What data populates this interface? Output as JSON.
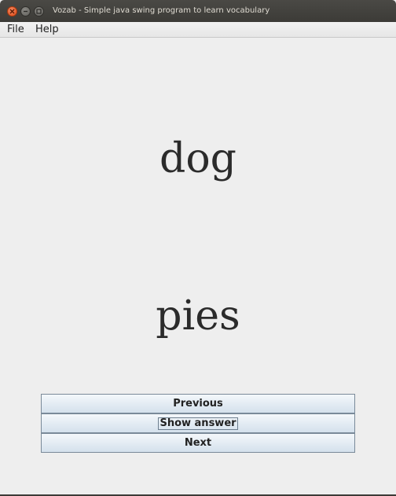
{
  "window": {
    "title": "Vozab - Simple java swing program to learn vocabulary"
  },
  "menubar": {
    "items": [
      {
        "label": "File"
      },
      {
        "label": "Help"
      }
    ]
  },
  "card": {
    "question": "dog",
    "answer": "pies"
  },
  "buttons": {
    "previous": "Previous",
    "show_answer": "Show answer",
    "next": "Next"
  },
  "colors": {
    "titlebar": "#3c3b37",
    "close_button": "#df4a16",
    "window_bg": "#eeeeee",
    "button_gradient_top": "#f4f8fb",
    "button_gradient_bottom": "#d4e1ec",
    "button_border": "#7a8a99"
  },
  "icons": {
    "close": "close-icon",
    "minimize": "minimize-icon",
    "maximize": "maximize-icon"
  }
}
